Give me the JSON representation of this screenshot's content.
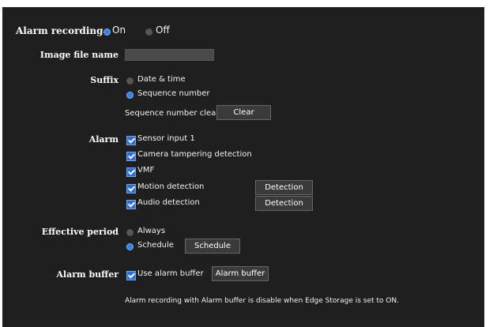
{
  "alarm_recording": {
    "label": "Alarm recording",
    "on_label": "On",
    "off_label": "Off",
    "selected": "On"
  },
  "image_file_name": {
    "label": "Image file name",
    "value": ""
  },
  "suffix": {
    "label": "Suffix",
    "options": [
      "Date & time",
      "Sequence number"
    ],
    "selected": "Sequence number",
    "clear_label": "Sequence number clear",
    "clear_button": "Clear"
  },
  "alarm": {
    "label": "Alarm",
    "items": [
      {
        "label": "Sensor input 1",
        "checked": true
      },
      {
        "label": "Camera tampering detection",
        "checked": true
      },
      {
        "label": "VMF",
        "checked": true
      },
      {
        "label": "Motion detection",
        "checked": true,
        "button": "Detection"
      },
      {
        "label": "Audio detection",
        "checked": true,
        "button": "Detection"
      }
    ]
  },
  "effective_period": {
    "label": "Effective period",
    "options": [
      "Always",
      "Schedule"
    ],
    "selected": "Schedule",
    "schedule_button": "Schedule"
  },
  "alarm_buffer": {
    "label": "Alarm buffer",
    "checkbox_label": "Use alarm buffer",
    "checked": true,
    "button": "Alarm buffer",
    "note": "Alarm recording with Alarm buffer is disable when Edge Storage is set to ON."
  },
  "colors": {
    "panel_bg": "#1f1f1f",
    "accent": "#3d82e0",
    "button_bg": "#3a3a3a"
  }
}
